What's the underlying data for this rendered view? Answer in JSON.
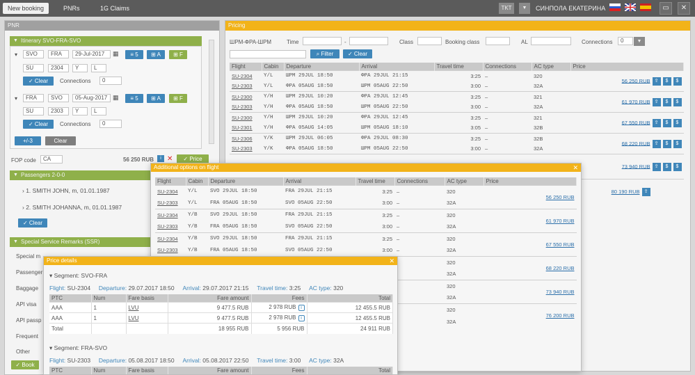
{
  "topbar": {
    "tabs": [
      "New booking",
      "PNRs",
      "1G Claims"
    ],
    "tkt": "TKT",
    "user": "СИНПОЛА ЕКАТЕРИНА"
  },
  "colors": {
    "accent_green": "#8fb04a",
    "accent_orange": "#f2b319",
    "accent_blue": "#3f86b9"
  },
  "pnr": {
    "title": "PNR",
    "itinerary_title": "Itinerary SVO-FRA-SVO",
    "segments": [
      {
        "from": "SVO",
        "to": "FRA",
        "date": "29-Jul-2017",
        "carrier": "SU",
        "flight": "2304",
        "cls": "Y",
        "sub": "L",
        "connections_label": "Connections",
        "connections": "0",
        "clear": "Clear"
      },
      {
        "from": "FRA",
        "to": "SVO",
        "date": "05-Aug-2017",
        "carrier": "SU",
        "flight": "2303",
        "cls": "Y",
        "sub": "L",
        "connections_label": "Connections",
        "connections": "0",
        "clear": "Clear"
      }
    ],
    "add_btn": "+/-3",
    "clear_btn": "Clear",
    "fop_label": "FOP code",
    "fop_value": "CA",
    "total_price": "56 250 RUB",
    "price_btn": "Price",
    "passengers_title": "Passengers 2-0-0",
    "passengers": [
      "1. SMITH JOHN, m, 01.01.1987",
      "2. SMITH JOHANNA, m, 01.01.1987"
    ],
    "passengers_clear": "Clear",
    "ssr_title": "Special Service Remarks (SSR)",
    "ssr_items": [
      "Special m",
      "Passenger",
      "Baggage",
      "API visa",
      "API passp",
      "Frequent",
      "Other"
    ],
    "book_btn": "Book"
  },
  "pricing": {
    "title": "Pricing",
    "route": "ШРМ-ФРА-ШРМ",
    "time_label": "Time",
    "class_label": "Class",
    "booking_class_label": "Booking class",
    "al_label": "AL",
    "connections_label": "Connections",
    "connections_value": "0",
    "filter_btn": "Filter",
    "clear_btn": "Clear",
    "columns": [
      "Flight",
      "Cabin",
      "Departure",
      "Arrival",
      "Travel time",
      "Connections",
      "AC type",
      "Price"
    ],
    "groups": [
      {
        "rows": [
          [
            "SU-2304",
            "Y/L",
            "ШРМ 29JUL 18:50",
            "ФРА 29JUL 21:15",
            "3:25",
            "–",
            "320"
          ],
          [
            "SU-2303",
            "Y/L",
            "ФРА 05AUG 18:50",
            "ШРМ 05AUG 22:50",
            "3:00",
            "–",
            "32A"
          ]
        ],
        "price": "56 250 RUB"
      },
      {
        "rows": [
          [
            "SU-2300",
            "Y/H",
            "ШРМ 29JUL 10:20",
            "ФРА 29JUL 12:45",
            "3:25",
            "–",
            "321"
          ],
          [
            "SU-2303",
            "Y/H",
            "ФРА 05AUG 18:50",
            "ШРМ 05AUG 22:50",
            "3:00",
            "–",
            "32A"
          ]
        ],
        "price": "61 970 RUB"
      },
      {
        "rows": [
          [
            "SU-2300",
            "Y/H",
            "ШРМ 29JUL 10:20",
            "ФРА 29JUL 12:45",
            "3:25",
            "–",
            "321"
          ],
          [
            "SU-2301",
            "Y/H",
            "ФРА 05AUG 14:05",
            "ШРМ 05AUG 18:10",
            "3:05",
            "–",
            "32B"
          ]
        ],
        "price": "67 550 RUB"
      },
      {
        "rows": [
          [
            "SU-2306",
            "Y/K",
            "ШРМ 29JUL 06:05",
            "ФРА 29JUL 08:30",
            "3:25",
            "–",
            "32B"
          ],
          [
            "SU-2303",
            "Y/K",
            "ФРА 05AUG 18:50",
            "ШРМ 05AUG 22:50",
            "3:00",
            "–",
            "32A"
          ]
        ],
        "price": "68 220 RUB"
      },
      {
        "rows": [],
        "price": "73 940 RUB"
      },
      {
        "rows": [],
        "price": "80 190 RUB"
      }
    ]
  },
  "options": {
    "title": "Additional options on flight",
    "columns": [
      "Flight",
      "Cabin",
      "Departure",
      "Arrival",
      "Travel time",
      "Connections",
      "AC type",
      "Price"
    ],
    "groups": [
      {
        "rows": [
          [
            "SU-2304",
            "Y/L",
            "SVO 29JUL 18:50",
            "FRA 29JUL 21:15",
            "3:25",
            "–",
            "320"
          ],
          [
            "SU-2303",
            "Y/L",
            "FRA 05AUG 18:50",
            "SVO 05AUG 22:50",
            "3:00",
            "–",
            "32A"
          ]
        ],
        "price": "56 250 RUB"
      },
      {
        "rows": [
          [
            "SU-2304",
            "Y/B",
            "SVO 29JUL 18:50",
            "FRA 29JUL 21:15",
            "3:25",
            "–",
            "320"
          ],
          [
            "SU-2303",
            "Y/B",
            "FRA 05AUG 18:50",
            "SVO 05AUG 22:50",
            "3:00",
            "–",
            "32A"
          ]
        ],
        "price": "61 970 RUB"
      },
      {
        "rows": [
          [
            "SU-2304",
            "Y/B",
            "SVO 29JUL 18:50",
            "FRA 29JUL 21:15",
            "3:25",
            "–",
            "320"
          ],
          [
            "SU-2303",
            "Y/B",
            "FRA 05AUG 18:50",
            "SVO 05AUG 22:50",
            "3:00",
            "–",
            "32A"
          ]
        ],
        "price": "67 550 RUB"
      },
      {
        "rows": [
          [
            "",
            "",
            "",
            "",
            "",
            "",
            "320"
          ],
          [
            "",
            "",
            "",
            "",
            "",
            "",
            "32A"
          ]
        ],
        "price": "68 220 RUB"
      },
      {
        "rows": [
          [
            "",
            "",
            "",
            "",
            "",
            "",
            "320"
          ],
          [
            "",
            "",
            "",
            "",
            "",
            "",
            "32A"
          ]
        ],
        "price": "73 940 RUB"
      },
      {
        "rows": [
          [
            "",
            "",
            "",
            "",
            "",
            "",
            "320"
          ],
          [
            "",
            "",
            "",
            "",
            "",
            "",
            "32A"
          ]
        ],
        "price": "76 200 RUB"
      }
    ]
  },
  "price_details": {
    "title": "Price details",
    "segments": [
      {
        "label": "Segment: SVO-FRA",
        "flight_label": "Flight:",
        "flight": "SU-2304",
        "dep_label": "Departure:",
        "dep": "29.07.2017 18:50",
        "arr_label": "Arrival:",
        "arr": "29.07.2017 21:15",
        "tt_label": "Travel time:",
        "tt": "3:25",
        "ac_label": "AC type:",
        "ac": "320",
        "columns": [
          "PTC",
          "Num",
          "Fare basis",
          "Fare amount",
          "Fees",
          "Total"
        ],
        "rows": [
          [
            "AAA",
            "1",
            "LVU",
            "9 477.5 RUB",
            "2 978 RUB",
            "12 455.5 RUB"
          ],
          [
            "AAA",
            "1",
            "LVU",
            "9 477.5 RUB",
            "2 978 RUB",
            "12 455.5 RUB"
          ],
          [
            "Total",
            "",
            "",
            "18 955 RUB",
            "5 956 RUB",
            "24 911 RUB"
          ]
        ]
      },
      {
        "label": "Segment: FRA-SVO",
        "flight_label": "Flight:",
        "flight": "SU-2303",
        "dep_label": "Departure:",
        "dep": "05.08.2017 18:50",
        "arr_label": "Arrival:",
        "arr": "05.08.2017 22:50",
        "tt_label": "Travel time:",
        "tt": "3:00",
        "ac_label": "AC type:",
        "ac": "32A",
        "columns": [
          "PTC",
          "Num",
          "Fare basis",
          "Fare amount",
          "Fees",
          "Total"
        ]
      }
    ]
  }
}
